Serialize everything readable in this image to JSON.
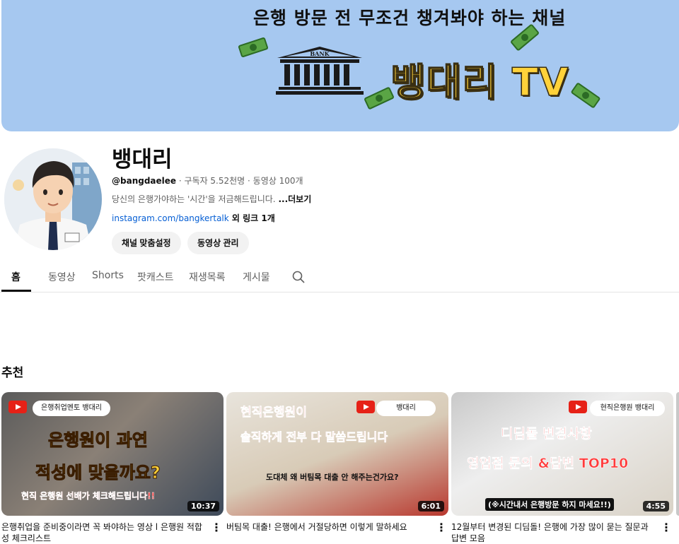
{
  "banner": {
    "tagline": "은행 방문 전  무조건 챙겨봐야 하는 채널",
    "brand": "뱅대리 TV",
    "bank_sign": "BANK"
  },
  "channel": {
    "name": "뱅대리",
    "handle": "@bangdaelee",
    "stats": " · 구독자 5.52천명 · 동영상 100개",
    "description": "당신의 은행가야하는 '시간'을 저금해드립니다.",
    "more": "...더보기",
    "link_url": "instagram.com/bangkertalk",
    "link_extra": " 외 링크 1개",
    "customize_button": "채널 맞춤설정",
    "manage_button": "동영상 관리"
  },
  "tabs": [
    "홈",
    "동영상",
    "Shorts",
    "팟캐스트",
    "재생목록",
    "게시물"
  ],
  "section_title": "추천",
  "videos": [
    {
      "title": "은행취업을 준비중이라면 꼭 봐야하는 영상 l 은행원 적합성 체크리스트",
      "duration": "10:37",
      "channel_pill": "은행취업멘토 뱅대리",
      "thumb_lines": [
        "은행원이 과연",
        "적성에 맞을까요?",
        "현직 은행원 선배가 체크해드립니다!!"
      ]
    },
    {
      "title": "버팀목 대출! 은행에서 거절당하면 이렇게 말하세요",
      "duration": "6:01",
      "channel_pill": "뱅대리",
      "thumb_lines": [
        "현직은행원이",
        "솔직하게 전부 다 말씀드립니다",
        "도대체 왜 버팀목 대출 안 해주는건가요?"
      ]
    },
    {
      "title": "12월부터 변경된 디딤돌! 은행에 가장 많이 묻는 질문과 답변 모음",
      "duration": "4:55",
      "channel_pill": "현직은행원 뱅대리",
      "thumb_lines": [
        "디딤돌 변경사항",
        "영업점 문의 &답변 TOP10",
        "(※시간내서 은행방문 하지 마세요!!)"
      ]
    }
  ],
  "colors": {
    "banner_bg": "#a6c8f0",
    "brand_yellow": "#ffd23a",
    "link_blue": "#065fd4",
    "youtube_red": "#e62117"
  }
}
